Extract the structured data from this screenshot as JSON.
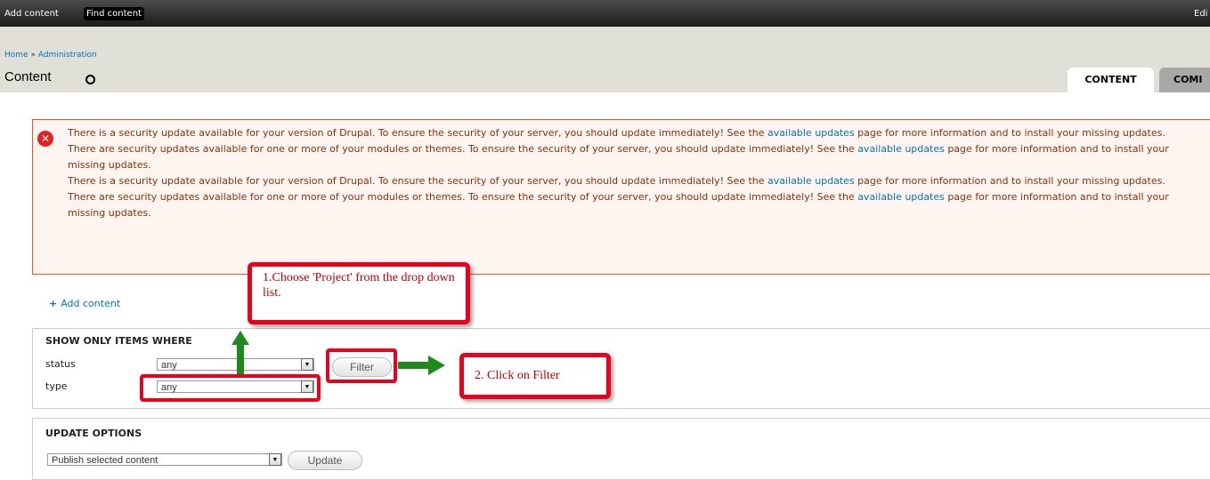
{
  "toolbar": {
    "add_content": "Add content",
    "find_content": "Find content",
    "edit_shortcuts": "Edi"
  },
  "header": {
    "breadcrumb": {
      "home": "Home",
      "separator": "»",
      "administration": "Administration"
    },
    "title": "Content",
    "tabs": [
      {
        "label": "CONTENT",
        "active": true
      },
      {
        "label": "COMI",
        "active": false
      }
    ]
  },
  "messages": {
    "icon": "error-icon",
    "items": [
      {
        "before": "There is a security update available for your version of Drupal. To ensure the security of your server, you should update immediately! See the ",
        "link": "available updates",
        "after": " page for more information and to install your missing updates."
      },
      {
        "before": "There are security updates available for one or more of your modules or themes. To ensure the security of your server, you should update immediately! See the ",
        "link": "available updates",
        "after": " page for more information and to install your missing updates."
      },
      {
        "before": "There is a security update available for your version of Drupal. To ensure the security of your server, you should update immediately! See the ",
        "link": "available updates",
        "after": " page for more information and to install your missing updates."
      },
      {
        "before": "There are security updates available for one or more of your modules or themes. To ensure the security of your server, you should update immediately! See the ",
        "link": "available updates",
        "after": " page for more information and to install your missing updates."
      }
    ]
  },
  "add_content_link": {
    "plus": "+",
    "label": "Add content"
  },
  "filters": {
    "legend": "SHOW ONLY ITEMS WHERE",
    "status_label": "status",
    "status_value": "any",
    "type_label": "type",
    "type_value": "any",
    "filter_button": "Filter"
  },
  "update_options": {
    "legend": "UPDATE OPTIONS",
    "operation_value": "Publish selected content",
    "update_button": "Update"
  },
  "annotations": {
    "callout_1": "1.Choose 'Project' from the drop down list.",
    "callout_2": "2. Click on Filter",
    "highlight_color": "#e8001c",
    "arrow_color": "#1e8a1e"
  }
}
